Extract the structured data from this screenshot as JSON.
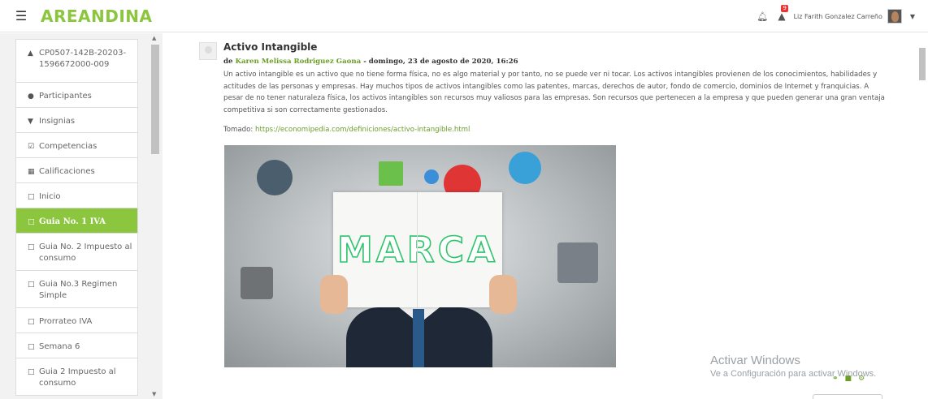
{
  "header": {
    "brand": "AREANDINA",
    "menu_icon": "hamburger-icon",
    "notification_icon": "bell-icon",
    "messages_icon": "chat-bubble-icon",
    "messages_count": "9",
    "user_name": "Liz Farith Gonzalez Carreño",
    "user_menu_icon": "caret-down-icon"
  },
  "sidebar": {
    "items": [
      {
        "icon": "graduation-cap-icon",
        "label": "CP0507-142B-20203-1596672000-009"
      },
      {
        "icon": "users-icon",
        "label": "Participantes"
      },
      {
        "icon": "shield-icon",
        "label": "Insignias"
      },
      {
        "icon": "check-square-icon",
        "label": "Competencias"
      },
      {
        "icon": "table-icon",
        "label": "Calificaciones"
      },
      {
        "icon": "folder-icon",
        "label": "Inicio"
      },
      {
        "icon": "folder-icon",
        "label": "Guia No. 1 IVA",
        "active": true
      },
      {
        "icon": "folder-icon",
        "label": "Guia No. 2 Impuesto al consumo"
      },
      {
        "icon": "folder-icon",
        "label": "Guia No.3 Regimen Simple"
      },
      {
        "icon": "folder-icon",
        "label": "Prorrateo IVA"
      },
      {
        "icon": "folder-icon",
        "label": "Semana 6"
      },
      {
        "icon": "folder-icon",
        "label": "Guia 2 Impuesto al consumo"
      }
    ]
  },
  "post": {
    "title": "Activo Intangible",
    "meta_prefix": "de",
    "author": "Karen Melissa Rodriguez Gaona",
    "meta_date": "- domingo, 23 de agosto de 2020, 16:26",
    "body": "Un activo intangible es un activo que no tiene forma física, no es algo material y por tanto, no se puede ver ni tocar. Los activos intangibles provienen de los conocimientos, habilidades y actitudes de las personas y empresas. Hay muchos tipos de activos intangibles como las patentes, marcas, derechos de autor, fondo de comercio, dominios de Internet y franquicias. A pesar de no tener naturaleza física, los activos intangibles son recursos muy valiosos para las empresas. Son recursos que pertenecen a la empresa y que pueden generar una gran ventaja competitiva si son correctamente gestionados.",
    "source_label": "Tomado:",
    "source_link": "https://economipedia.com/definiciones/activo-intangible.html",
    "image_word": "MARCA"
  },
  "watermark": {
    "line1": "Activar Windows",
    "line2": "Ve a Configuración para activar Windows."
  },
  "colors": {
    "brand_green": "#8cc63f",
    "link_green": "#6b9e2a"
  }
}
